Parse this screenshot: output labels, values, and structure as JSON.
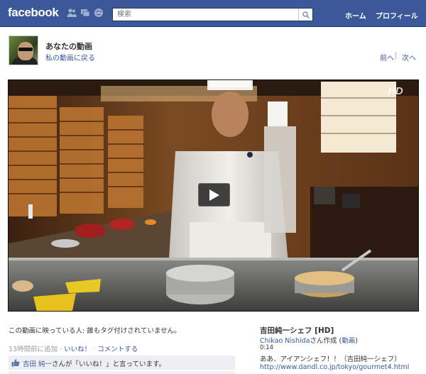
{
  "topbar": {
    "logo": "facebook",
    "search_placeholder": "検索",
    "nav": [
      "ホーム",
      "プロフィール"
    ]
  },
  "header": {
    "title": "あなたの動画",
    "back_link": "私の動画に戻る",
    "prev": "前へ",
    "next": "次へ"
  },
  "video": {
    "hd_badge": "HD"
  },
  "details": {
    "tagged": "この動画に映っている人: 誰もタグ付けされていません。",
    "time_ago": "13時間前に追加",
    "like_link": "いいね！",
    "comment_link": "コメントする",
    "like_user": "吉田 純一",
    "like_suffix": "さんが「いいね！」と言っています。"
  },
  "info": {
    "title": "吉田純一シェフ [HD]",
    "author": "Chikao Nishida",
    "author_suffix": "さん作成 (",
    "video_link": "動画",
    "author_close": ")",
    "duration": "0:14",
    "description": "ああ、アイアンシェフ！！（吉田純一シェフ）",
    "url": "http://www.dandl.co.jp/tokyo/gourmet4.html"
  },
  "colors": {
    "brand": "#3b5998",
    "link": "#3b5998",
    "like_bg": "#edeff4"
  }
}
